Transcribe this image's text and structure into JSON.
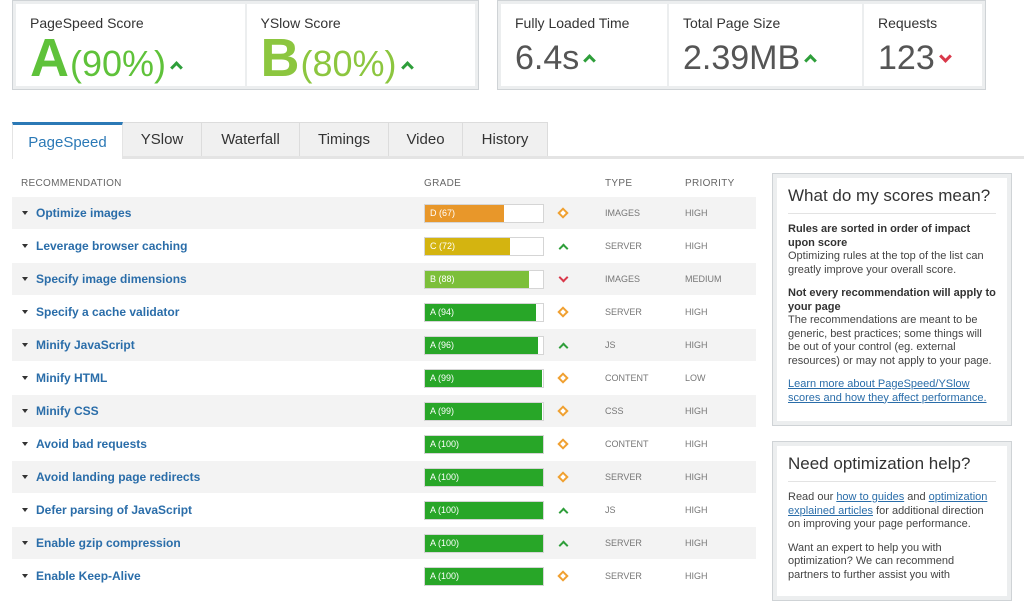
{
  "scores": {
    "pagespeed": {
      "label": "PageSpeed Score",
      "grade": "A",
      "percent": "(90%)"
    },
    "yslow": {
      "label": "YSlow Score",
      "grade": "B",
      "percent": "(80%)"
    },
    "fully_loaded": {
      "label": "Fully Loaded Time",
      "value": "6.4s"
    },
    "page_size": {
      "label": "Total Page Size",
      "value": "2.39MB"
    },
    "requests": {
      "label": "Requests",
      "value": "123"
    }
  },
  "tabs": [
    "PageSpeed",
    "YSlow",
    "Waterfall",
    "Timings",
    "Video",
    "History"
  ],
  "table": {
    "headers": {
      "recommendation": "RECOMMENDATION",
      "grade": "GRADE",
      "type": "TYPE",
      "priority": "PRIORITY"
    },
    "rows": [
      {
        "name": "Optimize images",
        "grade": "D (67)",
        "score": 67,
        "color": "#e8972a",
        "trend": "same",
        "type": "IMAGES",
        "priority": "HIGH"
      },
      {
        "name": "Leverage browser caching",
        "grade": "C (72)",
        "score": 72,
        "color": "#d4b410",
        "trend": "up",
        "type": "SERVER",
        "priority": "HIGH"
      },
      {
        "name": "Specify image dimensions",
        "grade": "B (88)",
        "score": 88,
        "color": "#7cbf3a",
        "trend": "down",
        "type": "IMAGES",
        "priority": "MEDIUM"
      },
      {
        "name": "Specify a cache validator",
        "grade": "A (94)",
        "score": 94,
        "color": "#28a628",
        "trend": "same",
        "type": "SERVER",
        "priority": "HIGH"
      },
      {
        "name": "Minify JavaScript",
        "grade": "A (96)",
        "score": 96,
        "color": "#28a628",
        "trend": "up",
        "type": "JS",
        "priority": "HIGH"
      },
      {
        "name": "Minify HTML",
        "grade": "A (99)",
        "score": 99,
        "color": "#28a628",
        "trend": "same",
        "type": "CONTENT",
        "priority": "LOW"
      },
      {
        "name": "Minify CSS",
        "grade": "A (99)",
        "score": 99,
        "color": "#28a628",
        "trend": "same",
        "type": "CSS",
        "priority": "HIGH"
      },
      {
        "name": "Avoid bad requests",
        "grade": "A (100)",
        "score": 100,
        "color": "#28a628",
        "trend": "same",
        "type": "CONTENT",
        "priority": "HIGH"
      },
      {
        "name": "Avoid landing page redirects",
        "grade": "A (100)",
        "score": 100,
        "color": "#28a628",
        "trend": "same",
        "type": "SERVER",
        "priority": "HIGH"
      },
      {
        "name": "Defer parsing of JavaScript",
        "grade": "A (100)",
        "score": 100,
        "color": "#28a628",
        "trend": "up",
        "type": "JS",
        "priority": "HIGH"
      },
      {
        "name": "Enable gzip compression",
        "grade": "A (100)",
        "score": 100,
        "color": "#28a628",
        "trend": "up",
        "type": "SERVER",
        "priority": "HIGH"
      },
      {
        "name": "Enable Keep-Alive",
        "grade": "A (100)",
        "score": 100,
        "color": "#28a628",
        "trend": "same",
        "type": "SERVER",
        "priority": "HIGH"
      }
    ]
  },
  "sidebar": {
    "scores_box": {
      "title": "What do my scores mean?",
      "h1": "Rules are sorted in order of impact upon score",
      "p1": "Optimizing rules at the top of the list can greatly improve your overall score.",
      "h2": "Not every recommendation will apply to your page",
      "p2": "The recommendations are meant to be generic, best practices; some things will be out of your control (eg. external resources) or may not apply to your page.",
      "link": "Learn more about PageSpeed/YSlow scores and how they affect performance."
    },
    "help_box": {
      "title": "Need optimization help?",
      "p1_a": "Read our ",
      "link1": "how to guides",
      "p1_b": " and ",
      "link2": "optimization explained articles",
      "p1_c": " for additional direction on improving your page performance.",
      "p2": "Want an expert to help you with optimization? We can recommend partners to further assist you with"
    }
  }
}
